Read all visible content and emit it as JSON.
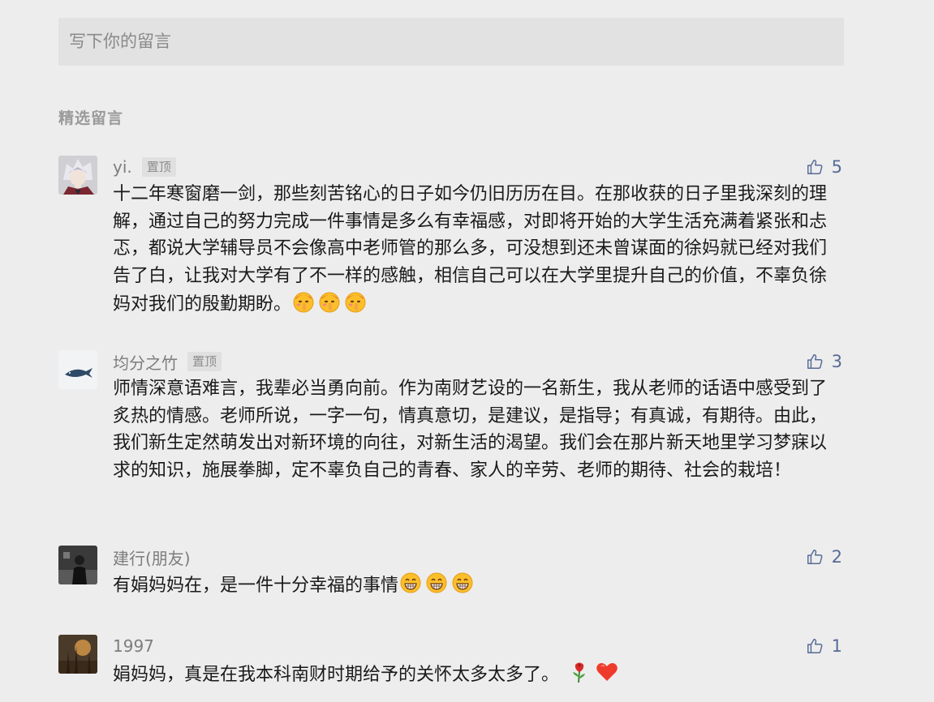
{
  "input": {
    "placeholder": "写下你的留言"
  },
  "section": {
    "title": "精选留言"
  },
  "comments": [
    {
      "nickname": "yi.",
      "badge": "置顶",
      "likes": "5",
      "text": "十二年寒窗磨一剑，那些刻苦铭心的日子如今仍旧历历在目。在那收获的日子里我深刻的理解，通过自己的努力完成一件事情是多么有幸福感，对即将开始的大学生活充满着紧张和忐忑，都说大学辅导员不会像高中老师管的那么多，可没想到还未曾谋面的徐妈就已经对我们告了白，让我对大学有了不一样的感触，相信自己可以在大学里提升自己的价值，不辜负徐妈对我们的殷勤期盼。",
      "emoji": "shush-face-icon"
    },
    {
      "nickname": "均分之竹",
      "badge": "置顶",
      "likes": "3",
      "text": "师情深意语难言，我辈必当勇向前。作为南财艺设的一名新生，我从老师的话语中感受到了炙热的情感。老师所说，一字一句，情真意切，是建议，是指导；有真诚，有期待。由此，我们新生定然萌发出对新环境的向往，对新生活的渴望。我们会在那片新天地里学习梦寐以求的知识，施展拳脚，定不辜负自己的青春、家人的辛劳、老师的期待、社会的栽培！"
    },
    {
      "nickname": "建行(朋友)",
      "likes": "2",
      "text": "有娟妈妈在，是一件十分幸福的事情",
      "emoji": "grin-face-icon"
    },
    {
      "nickname": "1997",
      "likes": "1",
      "text": "娟妈妈，真是在我本科南财时期给予的关怀太多太多了。",
      "emoji": "rose-heart-icon"
    }
  ],
  "colors": {
    "like": "#576b95",
    "background": "#ededed"
  }
}
